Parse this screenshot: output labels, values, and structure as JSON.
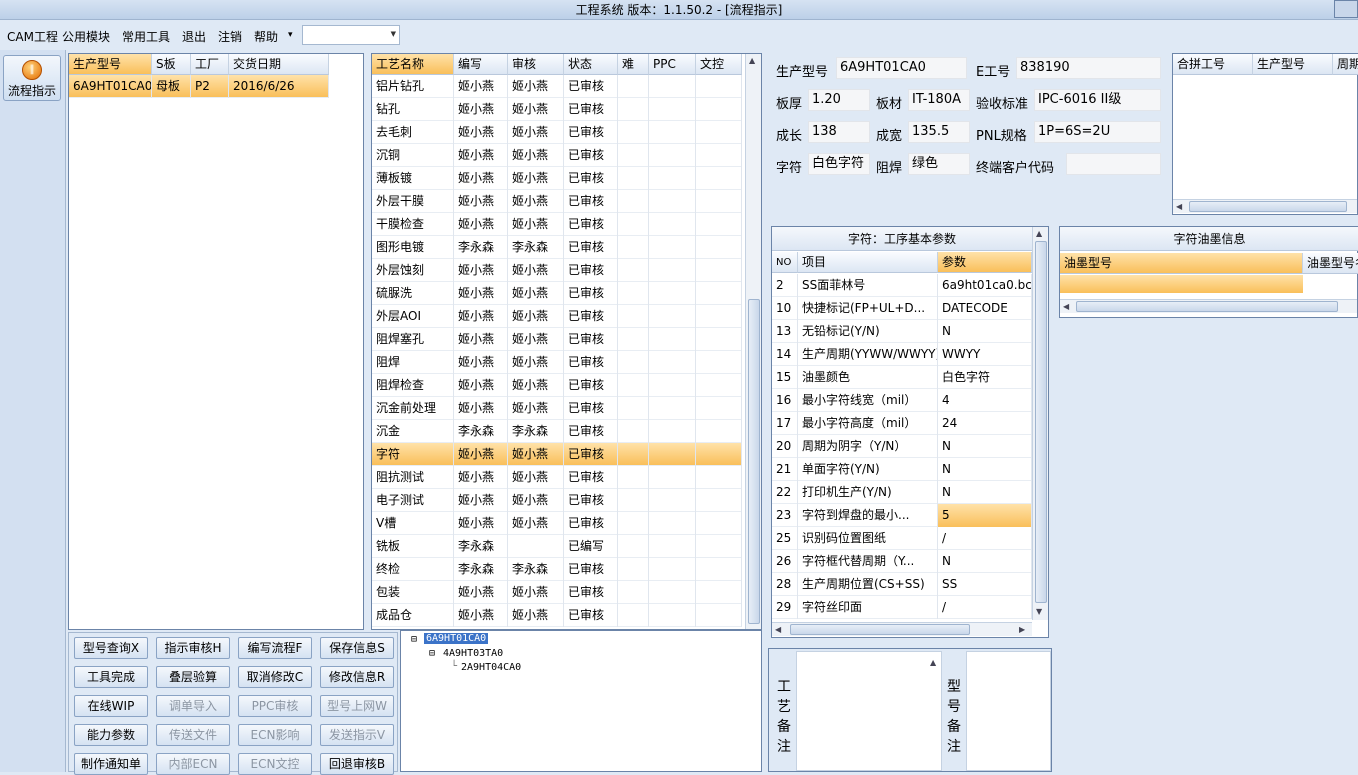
{
  "window": {
    "title": "工程系统  版本：1.1.50.2 - [流程指示]"
  },
  "menu": {
    "items": [
      "CAM工程",
      "公用模块",
      "常用工具",
      "退出",
      "注销",
      "帮助"
    ],
    "help_arrow": "▾",
    "combo_value": ""
  },
  "sidebar": {
    "flow_button": "流程指示"
  },
  "model_grid": {
    "headers": [
      "生产型号",
      "S板",
      "工厂",
      "交货日期"
    ],
    "rows": [
      [
        "6A9HT01CA0",
        "母板",
        "P2",
        "2016/6/26"
      ]
    ]
  },
  "process_grid": {
    "headers": [
      "工艺名称",
      "编写",
      "审核",
      "状态",
      "难",
      "PPC",
      "文控"
    ],
    "selected_index": 17,
    "rows": [
      [
        "铝片钻孔",
        "姬小燕",
        "姬小燕",
        "已审核"
      ],
      [
        "钻孔",
        "姬小燕",
        "姬小燕",
        "已审核"
      ],
      [
        "去毛刺",
        "姬小燕",
        "姬小燕",
        "已审核"
      ],
      [
        "沉铜",
        "姬小燕",
        "姬小燕",
        "已审核"
      ],
      [
        "薄板镀",
        "姬小燕",
        "姬小燕",
        "已审核"
      ],
      [
        "外层干膜",
        "姬小燕",
        "姬小燕",
        "已审核"
      ],
      [
        "干膜检查",
        "姬小燕",
        "姬小燕",
        "已审核"
      ],
      [
        "图形电镀",
        "李永森",
        "李永森",
        "已审核"
      ],
      [
        "外层蚀刻",
        "姬小燕",
        "姬小燕",
        "已审核"
      ],
      [
        "硫脲洗",
        "姬小燕",
        "姬小燕",
        "已审核"
      ],
      [
        "外层AOI",
        "姬小燕",
        "姬小燕",
        "已审核"
      ],
      [
        "阻焊塞孔",
        "姬小燕",
        "姬小燕",
        "已审核"
      ],
      [
        "阻焊",
        "姬小燕",
        "姬小燕",
        "已审核"
      ],
      [
        "阻焊检查",
        "姬小燕",
        "姬小燕",
        "已审核"
      ],
      [
        "沉金前处理",
        "姬小燕",
        "姬小燕",
        "已审核"
      ],
      [
        "沉金",
        "李永森",
        "李永森",
        "已审核"
      ],
      [
        "字符",
        "姬小燕",
        "姬小燕",
        "已审核"
      ],
      [
        "阻抗测试",
        "姬小燕",
        "姬小燕",
        "已审核"
      ],
      [
        "电子测试",
        "姬小燕",
        "姬小燕",
        "已审核"
      ],
      [
        "V槽",
        "姬小燕",
        "姬小燕",
        "已审核"
      ],
      [
        "铣板",
        "李永森",
        "",
        "已编写"
      ],
      [
        "终检",
        "李永森",
        "李永森",
        "已审核"
      ],
      [
        "包装",
        "姬小燕",
        "姬小燕",
        "已审核"
      ],
      [
        "成品仓",
        "姬小燕",
        "姬小燕",
        "已审核"
      ]
    ]
  },
  "info": {
    "model_label": "生产型号",
    "model_value": "6A9HT01CA0",
    "e_label": "E工号",
    "e_value": "838190",
    "thickness_label": "板厚",
    "thickness_value": "1.20",
    "material_label": "板材",
    "material_value": "IT-180A",
    "standard_label": "验收标准",
    "standard_value": "IPC-6016 II级",
    "length_label": "成长",
    "length_value": "138",
    "width_label": "成宽",
    "width_value": "135.5",
    "pnl_label": "PNL规格",
    "pnl_value": "1P=6S=2U",
    "char_label": "字符",
    "char_value": "白色字符",
    "mask_label": "阻焊",
    "mask_value": "绿色",
    "customer_label": "终端客户代码",
    "customer_value": ""
  },
  "merge_grid": {
    "headers": [
      "合拼工号",
      "生产型号",
      "周期"
    ]
  },
  "params": {
    "title": "字符：工序基本参数",
    "headers": [
      "NO",
      "项目",
      "参数"
    ],
    "selected_index": 11,
    "rows": [
      [
        "2",
        "SS面菲林号",
        "6a9ht01ca0.bc"
      ],
      [
        "10",
        "快捷标记(FP+UL+D...",
        "DATECODE"
      ],
      [
        "13",
        "无铅标记(Y/N)",
        "N"
      ],
      [
        "14",
        "生产周期(YYWW/WWYY)",
        "WWYY"
      ],
      [
        "15",
        "油墨颜色",
        "白色字符"
      ],
      [
        "16",
        "最小字符线宽（mil）",
        "4"
      ],
      [
        "17",
        "最小字符高度（mil）",
        "24"
      ],
      [
        "20",
        "周期为阴字（Y/N）",
        "N"
      ],
      [
        "21",
        "单面字符(Y/N)",
        "N"
      ],
      [
        "22",
        "打印机生产(Y/N)",
        "N"
      ],
      [
        "23",
        "字符到焊盘的最小...",
        "5"
      ],
      [
        "25",
        "识别码位置图纸",
        "/"
      ],
      [
        "26",
        "字符框代替周期（Y...",
        "N"
      ],
      [
        "28",
        "生产周期位置(CS+SS)",
        "SS"
      ],
      [
        "29",
        "字符丝印面",
        "/"
      ]
    ]
  },
  "ink": {
    "title": "字符油墨信息",
    "headers": [
      "油墨型号",
      "油墨型号名"
    ]
  },
  "buttons": [
    {
      "label": "型号查询X",
      "enabled": true
    },
    {
      "label": "指示审核H",
      "enabled": true
    },
    {
      "label": "编写流程F",
      "enabled": true
    },
    {
      "label": "保存信息S",
      "enabled": true
    },
    {
      "label": "工具完成",
      "enabled": true
    },
    {
      "label": "叠层验算",
      "enabled": true
    },
    {
      "label": "取消修改C",
      "enabled": true
    },
    {
      "label": "修改信息R",
      "enabled": true
    },
    {
      "label": "在线WIP",
      "enabled": true
    },
    {
      "label": "调单导入",
      "enabled": false
    },
    {
      "label": "PPC审核",
      "enabled": false
    },
    {
      "label": "型号上网W",
      "enabled": false
    },
    {
      "label": "能力参数",
      "enabled": true
    },
    {
      "label": "传送文件",
      "enabled": false
    },
    {
      "label": "ECN影响",
      "enabled": false
    },
    {
      "label": "发送指示V",
      "enabled": false
    },
    {
      "label": "制作通知单",
      "enabled": true
    },
    {
      "label": "内部ECN",
      "enabled": false
    },
    {
      "label": "ECN文控",
      "enabled": false
    },
    {
      "label": "回退审核B",
      "enabled": true
    }
  ],
  "tree": {
    "root": "6A9HT01CA0",
    "child": "4A9HT03TA0",
    "grandchild": "2A9HT04CA0"
  },
  "remarks": {
    "process_label": "工\n艺\n备\n注",
    "model_label": "型\n号\n备\n注"
  },
  "colors": {
    "selection": "#f9bf5a",
    "panel_bg": "#dfe9f5",
    "border": "#6b84a8"
  }
}
